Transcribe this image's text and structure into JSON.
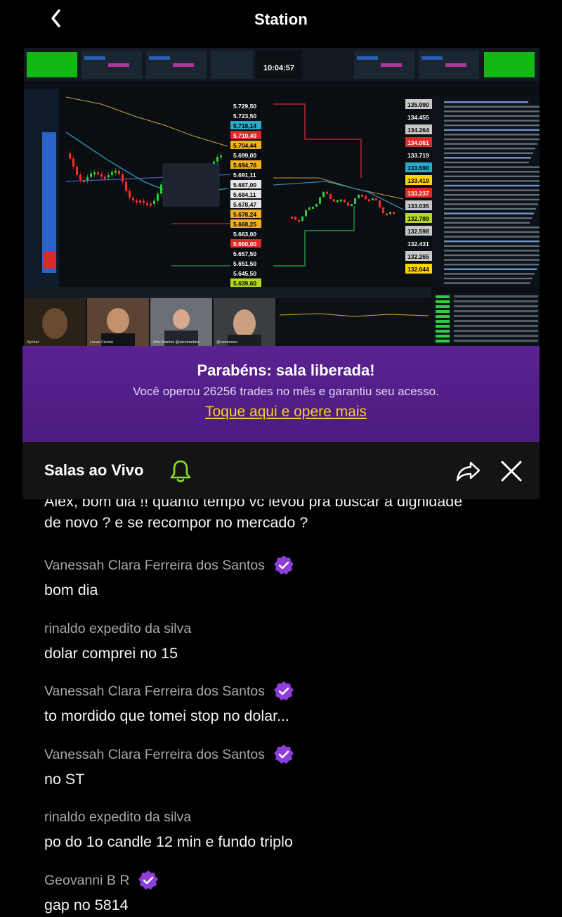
{
  "header": {
    "title": "Station"
  },
  "stream": {
    "clock": "10:04:57",
    "left_prices": [
      "5.729,50",
      "5.723,50",
      "5.718,14",
      "5.710,40",
      "5.704,44",
      "5.699,00",
      "5.694,76",
      "5.691,11",
      "5.687,00",
      "5.684,11",
      "5.678,47",
      "5.678,24",
      "5.668,25",
      "5.663,00",
      "5.660,00",
      "5.657,50",
      "5.651,50",
      "5.645,50",
      "5.639,60"
    ],
    "right_prices": [
      "135.990",
      "134.455",
      "134.264",
      "134.061",
      "133.719",
      "133.590",
      "133.419",
      "133.237",
      "133.035",
      "132.789",
      "132.598",
      "132.431",
      "132.265",
      "132.044"
    ],
    "participants": [
      "Rychar",
      "Lucas Fiorino",
      "Alex Martins @alexmartins",
      "@usmoreno"
    ],
    "colors": {
      "up": "#2ecc40",
      "down": "#ff2b2b",
      "accent": "#ffd400"
    }
  },
  "promo": {
    "title": "Parabéns: sala liberada!",
    "subtitle": "Você operou 26256 trades no mês e garantiu seu acesso.",
    "link": "Toque aqui e opere mais"
  },
  "rooms": {
    "title": "Salas ao Vivo",
    "icons": [
      "bell-icon",
      "share-icon",
      "close-icon"
    ]
  },
  "chat": {
    "messages": [
      {
        "author": "",
        "verified": false,
        "lines": [
          "Alex, bom dia !! quanto tempo vc levou pra buscar a dignidade",
          "de novo ? e se recompor no mercado ?"
        ]
      },
      {
        "author": "Vanessah Clara Ferreira dos Santos",
        "verified": true,
        "lines": [
          "bom dia"
        ]
      },
      {
        "author": "rinaldo expedito da silva",
        "verified": false,
        "lines": [
          "dolar comprei no 15"
        ]
      },
      {
        "author": "Vanessah Clara Ferreira dos Santos",
        "verified": true,
        "lines": [
          "to mordido que tomei stop no dolar..."
        ]
      },
      {
        "author": "Vanessah Clara Ferreira dos Santos",
        "verified": true,
        "lines": [
          "no ST"
        ]
      },
      {
        "author": "rinaldo expedito da silva",
        "verified": false,
        "lines": [
          "po do 1o candle 12 min e fundo triplo"
        ]
      },
      {
        "author": "Geovanni B R",
        "verified": true,
        "lines": [
          "gap no 5814"
        ]
      }
    ]
  }
}
